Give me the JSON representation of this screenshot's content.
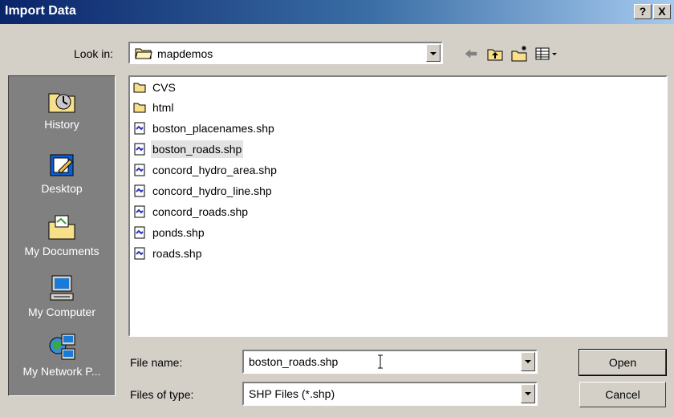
{
  "window": {
    "title": "Import Data",
    "help_btn": "?",
    "close_btn": "X"
  },
  "look_in": {
    "label": "Look in:",
    "value": "mapdemos"
  },
  "places": [
    {
      "label": "History",
      "icon": "history-icon"
    },
    {
      "label": "Desktop",
      "icon": "desktop-icon"
    },
    {
      "label": "My Documents",
      "icon": "my-documents-icon"
    },
    {
      "label": "My Computer",
      "icon": "my-computer-icon"
    },
    {
      "label": "My Network P...",
      "icon": "my-network-places-icon"
    }
  ],
  "files": [
    {
      "name": "CVS",
      "type": "folder"
    },
    {
      "name": "html",
      "type": "folder"
    },
    {
      "name": "boston_placenames.shp",
      "type": "shp"
    },
    {
      "name": "boston_roads.shp",
      "type": "shp",
      "selected": true
    },
    {
      "name": "concord_hydro_area.shp",
      "type": "shp"
    },
    {
      "name": "concord_hydro_line.shp",
      "type": "shp"
    },
    {
      "name": "concord_roads.shp",
      "type": "shp"
    },
    {
      "name": "ponds.shp",
      "type": "shp"
    },
    {
      "name": "roads.shp",
      "type": "shp"
    }
  ],
  "file_name": {
    "label": "File name:",
    "value": "boston_roads.shp"
  },
  "file_type": {
    "label": "Files of type:",
    "value": "SHP Files (*.shp)"
  },
  "buttons": {
    "open": "Open",
    "cancel": "Cancel"
  },
  "toolbar_icons": [
    "back-arrow-icon",
    "up-folder-icon",
    "new-folder-icon",
    "view-menu-icon"
  ]
}
